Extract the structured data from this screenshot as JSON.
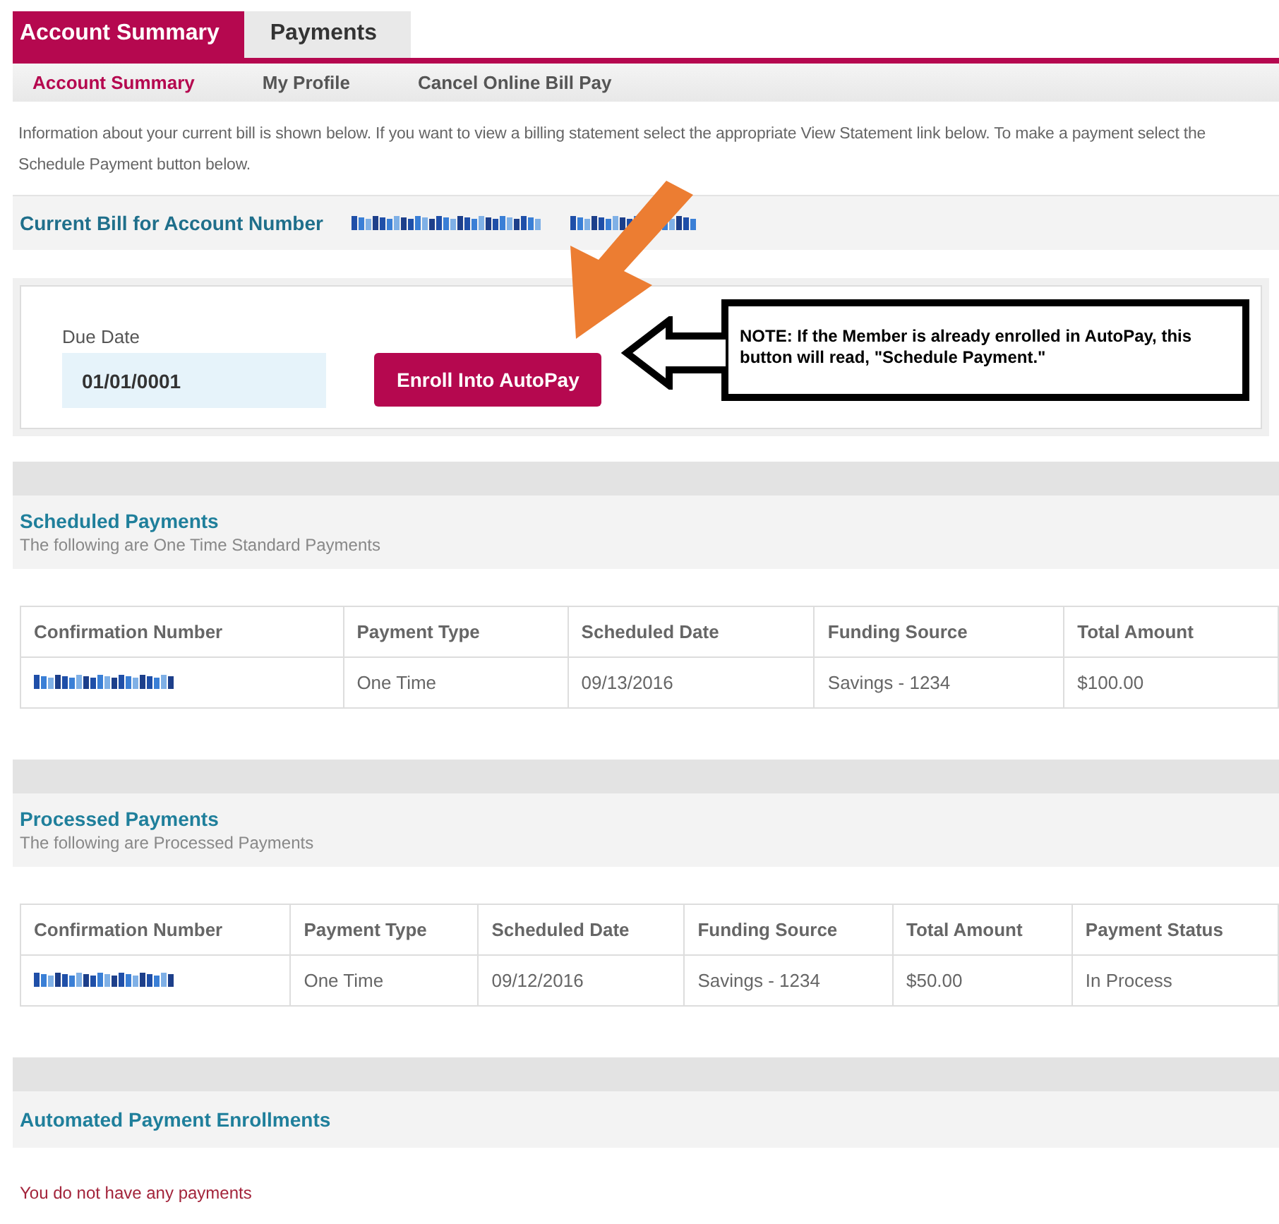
{
  "tabs": [
    {
      "label": "Account Summary",
      "selected": true
    },
    {
      "label": "Payments",
      "selected": false
    }
  ],
  "subnav": [
    {
      "label": "Account Summary",
      "selected": true
    },
    {
      "label": "My Profile",
      "selected": false
    },
    {
      "label": "Cancel Online Bill Pay",
      "selected": false
    }
  ],
  "intro": "Information about your current bill is shown below. If you want to view a billing statement select the appropriate View Statement link below. To make a payment select the Schedule Payment button below.",
  "current_bill": {
    "label": "Current Bill for Account Number",
    "redacted": true
  },
  "due": {
    "label": "Due Date",
    "value": "01/01/0001",
    "button": "Enroll Into AutoPay"
  },
  "note": "NOTE: If the Member is already enrolled in AutoPay, this button will read, \"Schedule Payment.\"",
  "scheduled": {
    "title": "Scheduled Payments",
    "subtitle": "The following are One Time Standard Payments",
    "columns": [
      "Confirmation Number",
      "Payment Type",
      "Scheduled Date",
      "Funding Source",
      "Total Amount"
    ],
    "rows": [
      {
        "redacted": true,
        "cells": [
          "",
          "One Time",
          "09/13/2016",
          "Savings - 1234",
          "$100.00"
        ]
      }
    ]
  },
  "processed": {
    "title": "Processed Payments",
    "subtitle": "The following are Processed Payments",
    "columns": [
      "Confirmation Number",
      "Payment Type",
      "Scheduled Date",
      "Funding Source",
      "Total Amount",
      "Payment Status"
    ],
    "rows": [
      {
        "redacted": true,
        "cells": [
          "",
          "One Time",
          "09/12/2016",
          "Savings - 1234",
          "$50.00",
          "In Process"
        ]
      }
    ]
  },
  "automated": {
    "title": "Automated Payment Enrollments",
    "empty": "You do not have any payments"
  }
}
